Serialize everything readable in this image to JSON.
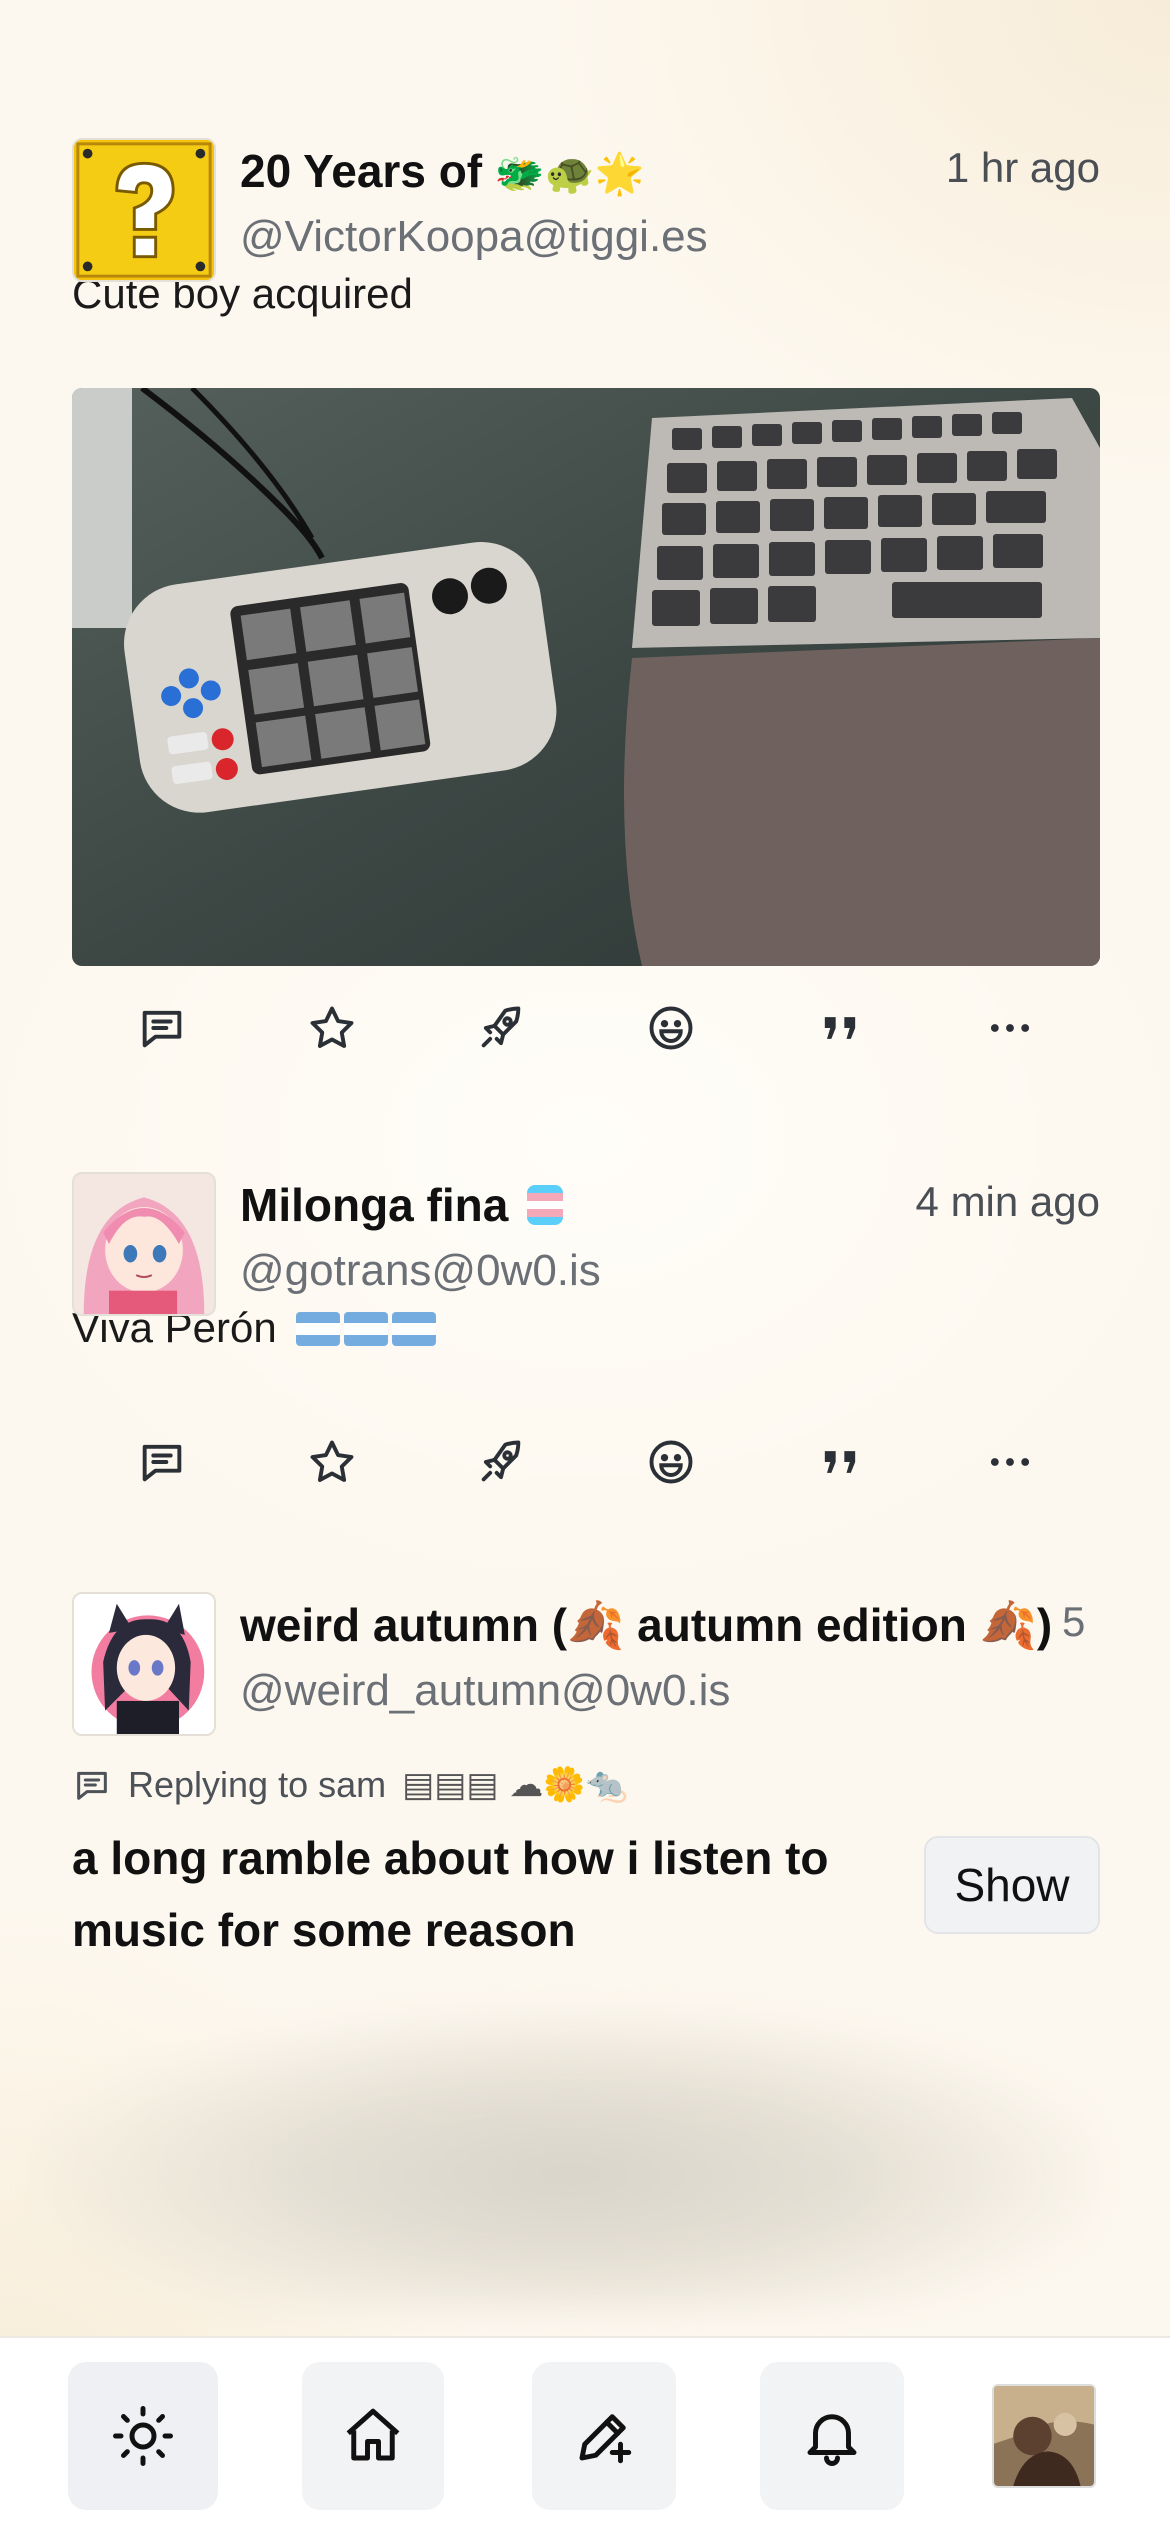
{
  "posts": [
    {
      "display_name": "20 Years of",
      "name_emojis": "🐲🐢🌟",
      "handle": "@VictorKoopa@tiggi.es",
      "time": "1 hr ago",
      "text": "Cute boy acquired",
      "avatar_icon": "question-block-icon"
    },
    {
      "display_name": "Milonga fina",
      "name_emojis": "🏳️‍⚧️",
      "handle": "@gotrans@0w0.is",
      "time": "4 min ago",
      "text": "Viva Perón",
      "text_emojis": "🇦🇷🇦🇷🇦🇷"
    },
    {
      "display_name": "weird autumn (🍂 autumn edition 🍂)",
      "handle": "@weird_autumn@0w0.is",
      "time": "5 ",
      "reply_to": "Replying to sam",
      "reply_emojis": "▤▤▤ ☁🌼🐀",
      "cw_text": "a long ramble about how i listen to music for some reason",
      "show_label": "Show"
    }
  ],
  "bottom_nav": {
    "items": [
      "theme-toggle",
      "home",
      "compose",
      "notifications",
      "profile"
    ]
  },
  "colors": {
    "background": "#fdf8ef",
    "icon": "#2b2f36",
    "handle": "#6b6f76"
  }
}
